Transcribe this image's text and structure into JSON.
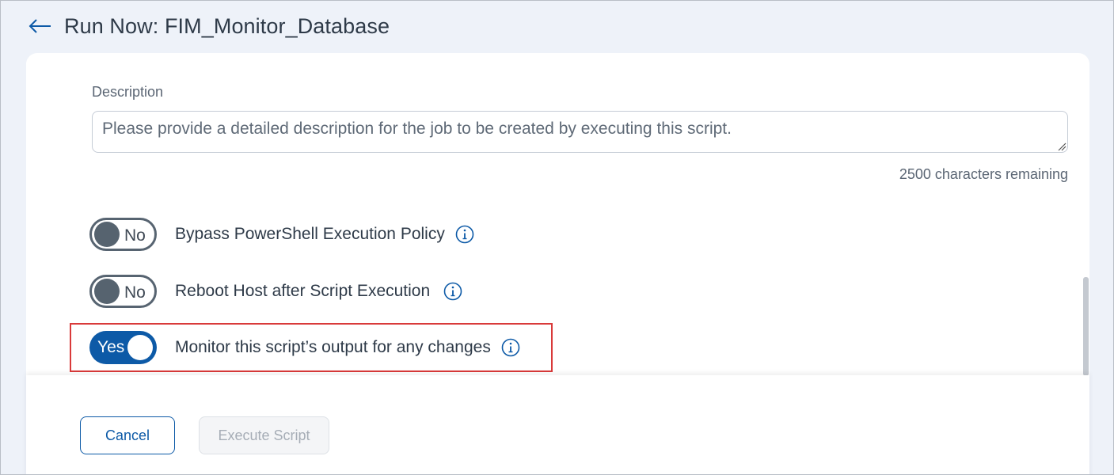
{
  "header": {
    "title": "Run Now: FIM_Monitor_Database",
    "back_icon": "arrow-left-icon"
  },
  "description": {
    "label": "Description",
    "placeholder": "Please provide a detailed description for the job to be created by executing this script.",
    "value": "",
    "chars_remaining": "2500 characters remaining"
  },
  "options": [
    {
      "label": "Bypass PowerShell Execution Policy",
      "state_label": "No",
      "enabled": false,
      "icon": "info-icon"
    },
    {
      "label": "Reboot Host after Script Execution",
      "state_label": "No",
      "enabled": false,
      "icon": "info-icon"
    },
    {
      "label": "Monitor this script’s output for any changes",
      "state_label": "Yes",
      "enabled": true,
      "icon": "info-icon"
    }
  ],
  "footer": {
    "cancel_label": "Cancel",
    "execute_label": "Execute Script"
  },
  "colors": {
    "accent": "#0d5aa7",
    "highlight": "#d93a3a",
    "background": "#eef2f9"
  }
}
